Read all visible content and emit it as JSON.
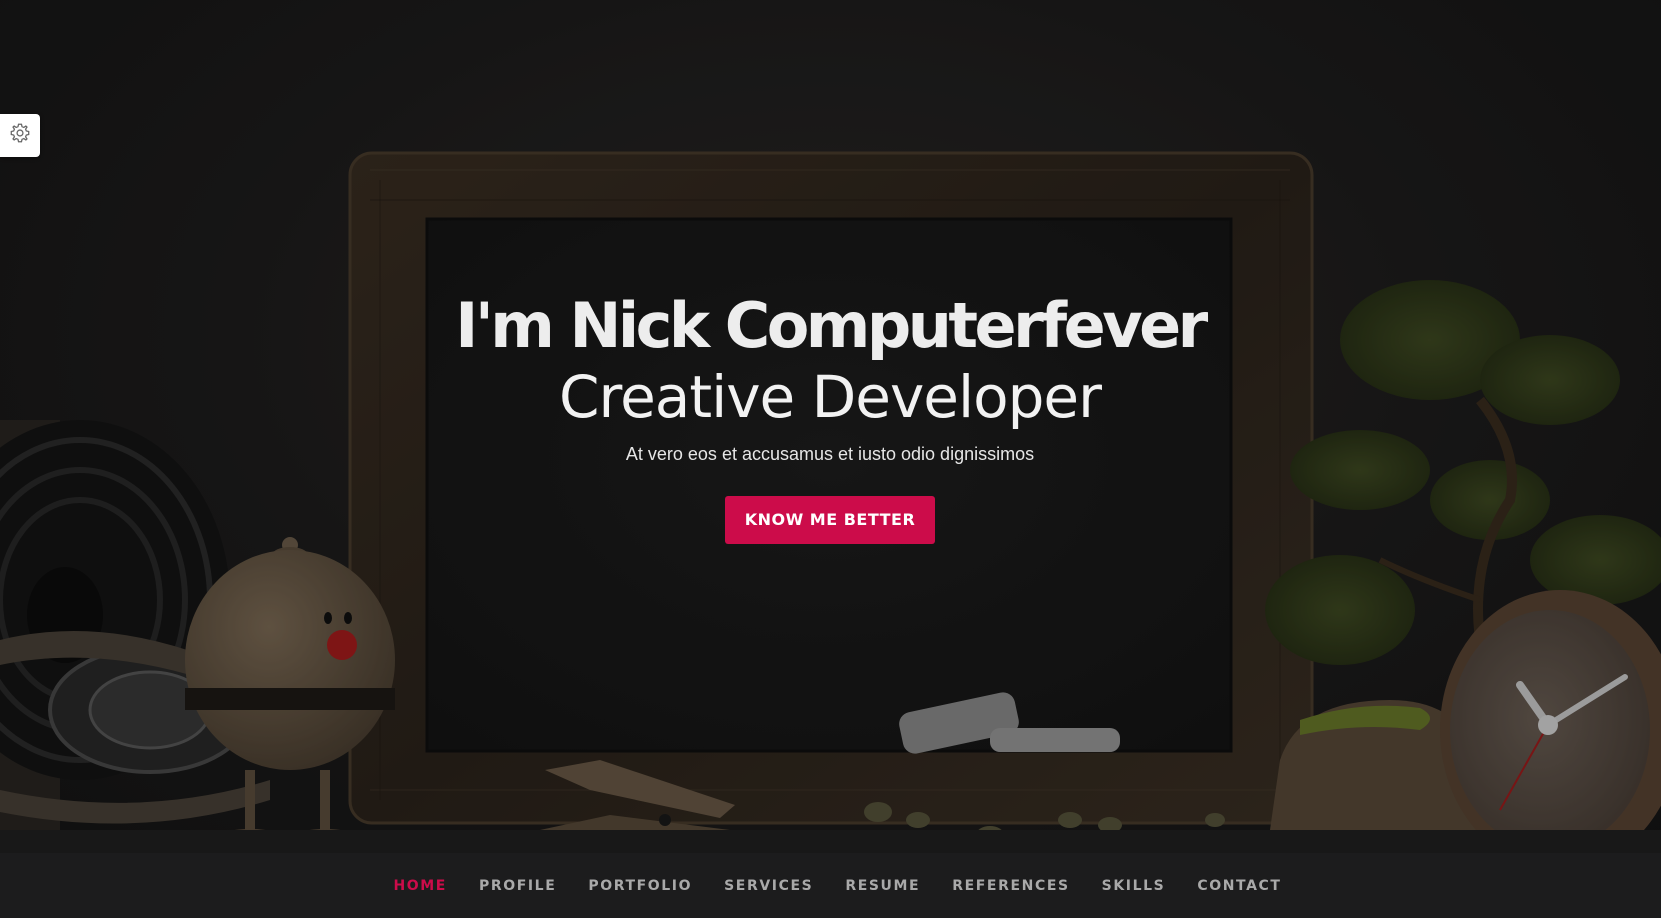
{
  "settings": {
    "icon": "gear-icon"
  },
  "hero": {
    "title": "I'm Nick Computerfever",
    "subtitle": "Creative Developer",
    "tagline": "At vero eos et accusamus et iusto odio dignissimos",
    "cta_label": "KNOW ME BETTER"
  },
  "nav": {
    "items": [
      {
        "label": "HOME",
        "active": true
      },
      {
        "label": "PROFILE",
        "active": false
      },
      {
        "label": "PORTFOLIO",
        "active": false
      },
      {
        "label": "SERVICES",
        "active": false
      },
      {
        "label": "RESUME",
        "active": false
      },
      {
        "label": "REFERENCES",
        "active": false
      },
      {
        "label": "SKILLS",
        "active": false
      },
      {
        "label": "CONTACT",
        "active": false
      }
    ]
  },
  "colors": {
    "accent": "#cc0c4a",
    "nav_text": "#a9a9a9",
    "nav_bg": "#1c1c1d",
    "hero_bg": "#1d1c1c"
  }
}
